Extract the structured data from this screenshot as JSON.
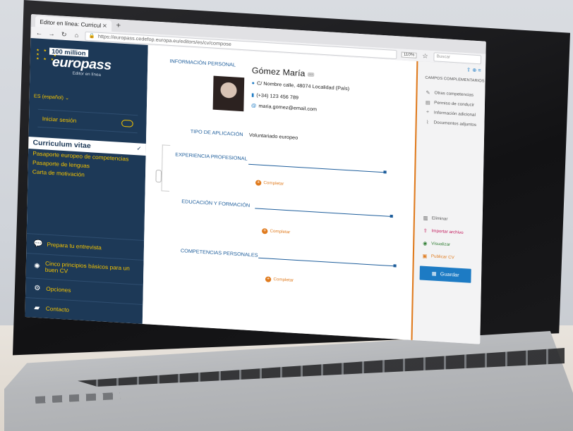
{
  "browser": {
    "tab_title": "Editor en línea: Curricul",
    "url": "https://europass.cedefop.europa.eu/editors/es/cv/compose",
    "zoom": "110%",
    "search_placeholder": "Buscar"
  },
  "sidebar": {
    "million_badge": "100 million",
    "brand": "europass",
    "editor_label": "Editor en línea",
    "language": "ES (español)",
    "login": "Iniciar sesión",
    "active_item": "Curriculum vitae",
    "items": [
      {
        "label": "Pasaporte europeo de competencias"
      },
      {
        "label": "Pasaporte de lenguas"
      },
      {
        "label": "Carta de motivación"
      }
    ],
    "bottom": [
      {
        "label": "Prepara tu entrevista"
      },
      {
        "label": "Cinco principios básicos para un buen CV"
      },
      {
        "label": "Opciones"
      },
      {
        "label": "Contacto"
      }
    ]
  },
  "cv": {
    "personal_label": "INFORMACIÓN PERSONAL",
    "name": "Gómez María",
    "address": "C/ Nombre calle, 48074 Localidad (País)",
    "phone": "(+34) 123 456 789",
    "email": "maria.gomez@email.com",
    "app_type_label": "TIPO DE APLICACIÓN",
    "app_type_value": "Voluntariado europeo",
    "sections": [
      {
        "label": "EXPERIENCIA PROFESIONAL",
        "action": "Completar"
      },
      {
        "label": "EDUCACIÓN Y FORMACIÓN",
        "action": "Completar"
      },
      {
        "label": "COMPETENCIAS PERSONALES",
        "action": "Completar"
      }
    ]
  },
  "right_panel": {
    "heading": "CAMPOS COMPLEMENTARIOS",
    "items": [
      {
        "label": "Otras competencias"
      },
      {
        "label": "Permiso de conducir"
      },
      {
        "label": "Información adicional"
      },
      {
        "label": "Documentos adjuntos"
      }
    ],
    "actions": [
      {
        "label": "Eliminar"
      },
      {
        "label": "Importar archivo"
      },
      {
        "label": "Visualizar"
      },
      {
        "label": "Publicar CV"
      }
    ],
    "save": "Guardar"
  }
}
